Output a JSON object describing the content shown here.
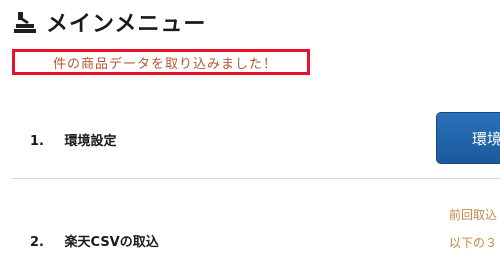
{
  "header": {
    "title": "メインメニュー",
    "icon": "stamp-icon"
  },
  "alert": {
    "message": "件の商品データを取り込みました！",
    "border_color": "#e8102a",
    "text_color": "#b5562d"
  },
  "menu": [
    {
      "number": "1.",
      "label": "環境設定",
      "button_label": "環境"
    },
    {
      "number": "2.",
      "label": "楽天CSVの取込",
      "info_lines": [
        "前回取込",
        "以下の３"
      ]
    }
  ],
  "colors": {
    "button": "#1f65ad",
    "info_text": "#c08a44"
  }
}
